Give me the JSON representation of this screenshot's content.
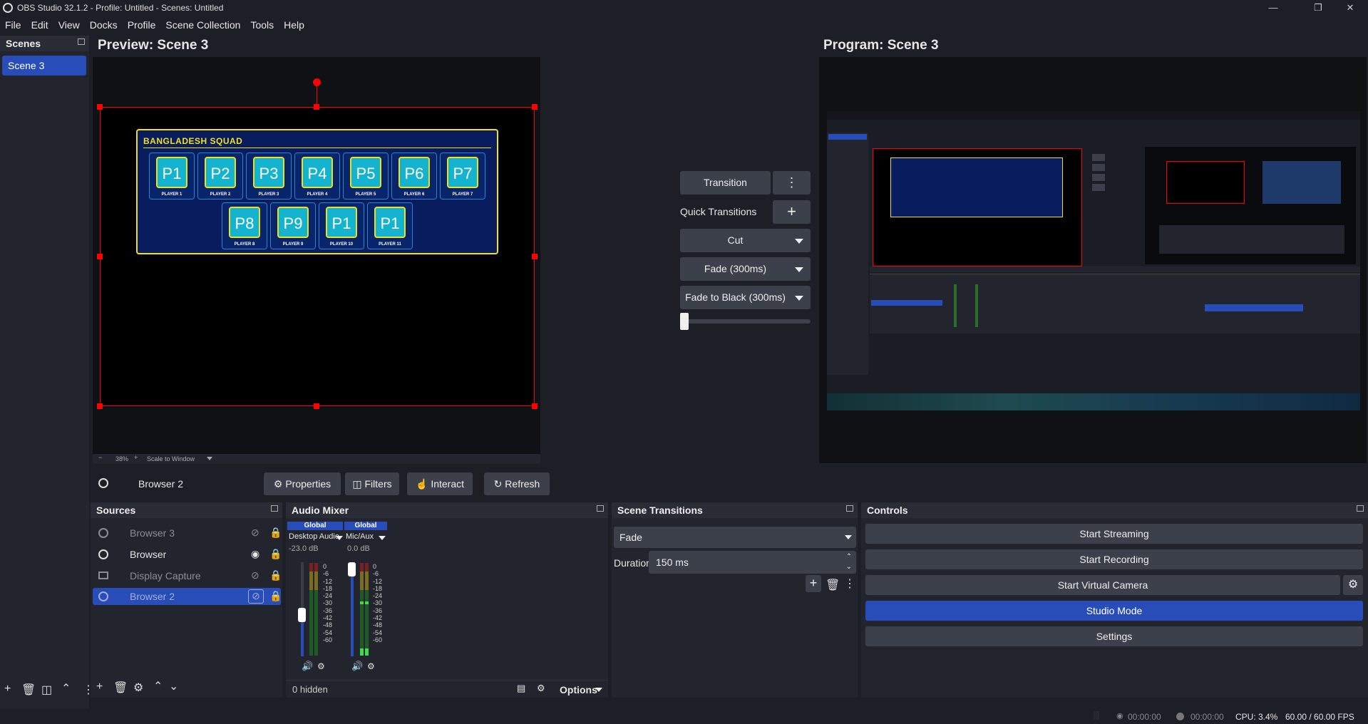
{
  "window": {
    "title": "OBS Studio 32.1.2 - Profile: Untitled - Scenes: Untitled"
  },
  "menu": [
    "File",
    "Edit",
    "View",
    "Docks",
    "Profile",
    "Scene Collection",
    "Tools",
    "Help"
  ],
  "scenes": {
    "title": "Scenes",
    "items": [
      "Scene 3"
    ]
  },
  "preview": {
    "title": "Preview: Scene 3",
    "zoom": "38%",
    "scale_mode": "Scale to Window",
    "squad_title": "BANGLADESH SQUAD",
    "players": [
      {
        "box": "P1",
        "label": "PLAYER 1"
      },
      {
        "box": "P2",
        "label": "PLAYER 2"
      },
      {
        "box": "P3",
        "label": "PLAYER 3"
      },
      {
        "box": "P4",
        "label": "PLAYER 4"
      },
      {
        "box": "P5",
        "label": "PLAYER 5"
      },
      {
        "box": "P6",
        "label": "PLAYER 6"
      },
      {
        "box": "P7",
        "label": "PLAYER 7"
      },
      {
        "box": "P8",
        "label": "PLAYER 8"
      },
      {
        "box": "P9",
        "label": "PLAYER 9"
      },
      {
        "box": "P1",
        "label": "PLAYER 10"
      },
      {
        "box": "P1",
        "label": "PLAYER 11"
      }
    ]
  },
  "program": {
    "title": "Program: Scene 3"
  },
  "transitions_center": {
    "transition_button": "Transition",
    "quick_transitions": "Quick Transitions",
    "items": [
      "Cut",
      "Fade (300ms)",
      "Fade to Black (300ms)"
    ]
  },
  "source_toolbar": {
    "selected_source": "Browser 2",
    "properties": "Properties",
    "filters": "Filters",
    "interact": "Interact",
    "refresh": "Refresh"
  },
  "sources": {
    "title": "Sources",
    "items": [
      {
        "name": "Browser 3",
        "visible": false,
        "selected": false
      },
      {
        "name": "Browser",
        "visible": true,
        "selected": false
      },
      {
        "name": "Display Capture",
        "visible": false,
        "selected": false
      },
      {
        "name": "Browser 2",
        "visible": false,
        "selected": true
      }
    ]
  },
  "audio_mixer": {
    "title": "Audio Mixer",
    "channels": [
      {
        "badge": "Global",
        "name": "Desktop Audio",
        "db": "-23.0 dB"
      },
      {
        "badge": "Global",
        "name": "Mic/Aux",
        "db": "0.0 dB"
      }
    ],
    "scale": [
      "0",
      "-6",
      "-12",
      "-18",
      "-24",
      "-30",
      "-36",
      "-42",
      "-48",
      "-54",
      "-60"
    ],
    "hidden": "0 hidden",
    "options": "Options"
  },
  "scene_transitions": {
    "title": "Scene Transitions",
    "selected": "Fade",
    "duration_label": "Duration",
    "duration_value": "150 ms"
  },
  "controls": {
    "title": "Controls",
    "start_streaming": "Start Streaming",
    "start_recording": "Start Recording",
    "start_virtual_camera": "Start Virtual Camera",
    "studio_mode": "Studio Mode",
    "settings": "Settings"
  },
  "status": {
    "stream_time": "00:00:00",
    "record_time": "00:00:00",
    "cpu": "CPU: 3.4%",
    "fps": "60.00 / 60.00 FPS"
  },
  "colors": {
    "accent": "#284cb8",
    "background": "#1d1f26",
    "panel": "#22252d",
    "selection": "#ff0000"
  }
}
